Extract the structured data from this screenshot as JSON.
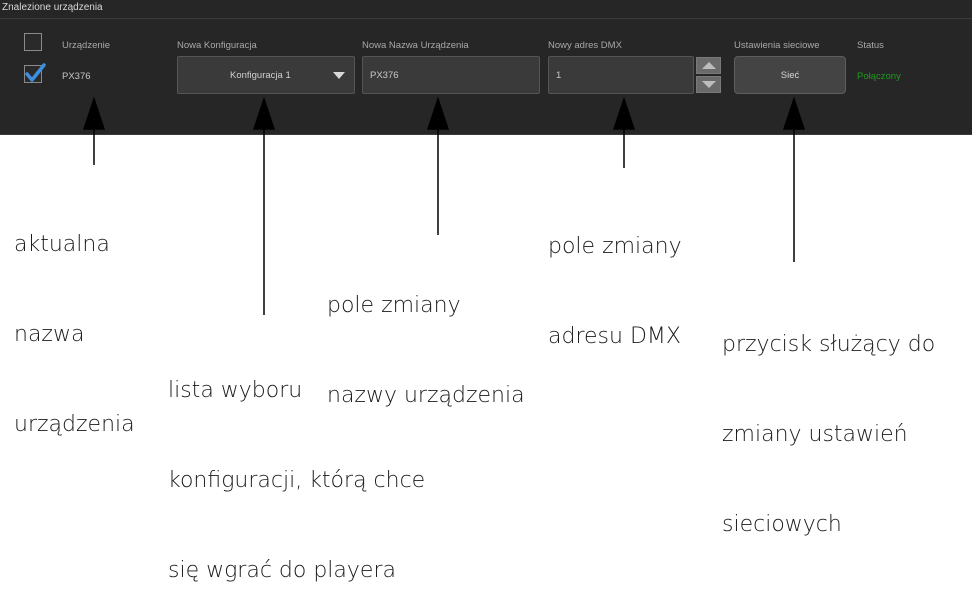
{
  "panel": {
    "title": "Znalezione urządzenia",
    "headers": {
      "device": "Urządzenie",
      "new_config": "Nowa Konfiguracja",
      "new_name": "Nowa Nazwa Urządzenia",
      "new_dmx": "Nowy adres DMX",
      "network": "Ustawienia sieciowe",
      "status": "Status"
    },
    "row": {
      "checked": true,
      "device_name": "PX376",
      "config_value": "Konfiguracja 1",
      "new_name_value": "PX376",
      "dmx_value": "1",
      "network_button": "Sieć",
      "status": "Połączony"
    }
  },
  "colors": {
    "panel_bg": "#262626",
    "check_blue": "#3d8fe0",
    "status_green": "#1f9a1f",
    "annotation_text": "#1a1a1a"
  },
  "icons": {
    "checkbox_check": "check-icon",
    "dropdown": "triangle-down-icon",
    "spin_up": "triangle-up-icon",
    "spin_down": "triangle-down-icon"
  },
  "annotations": {
    "device_name": [
      "aktualna",
      "nazwa",
      "urządzenia"
    ],
    "config_list": [
      "lista wyboru",
      "konfiguracji, którą chce",
      "się wgrać do playera"
    ],
    "name_field": [
      "pole zmiany",
      "nazwy urządzenia"
    ],
    "dmx_field": [
      "pole zmiany",
      "adresu DMX"
    ],
    "network_button": [
      "przycisk służący do",
      "zmiany ustawień",
      "sieciowych"
    ]
  }
}
